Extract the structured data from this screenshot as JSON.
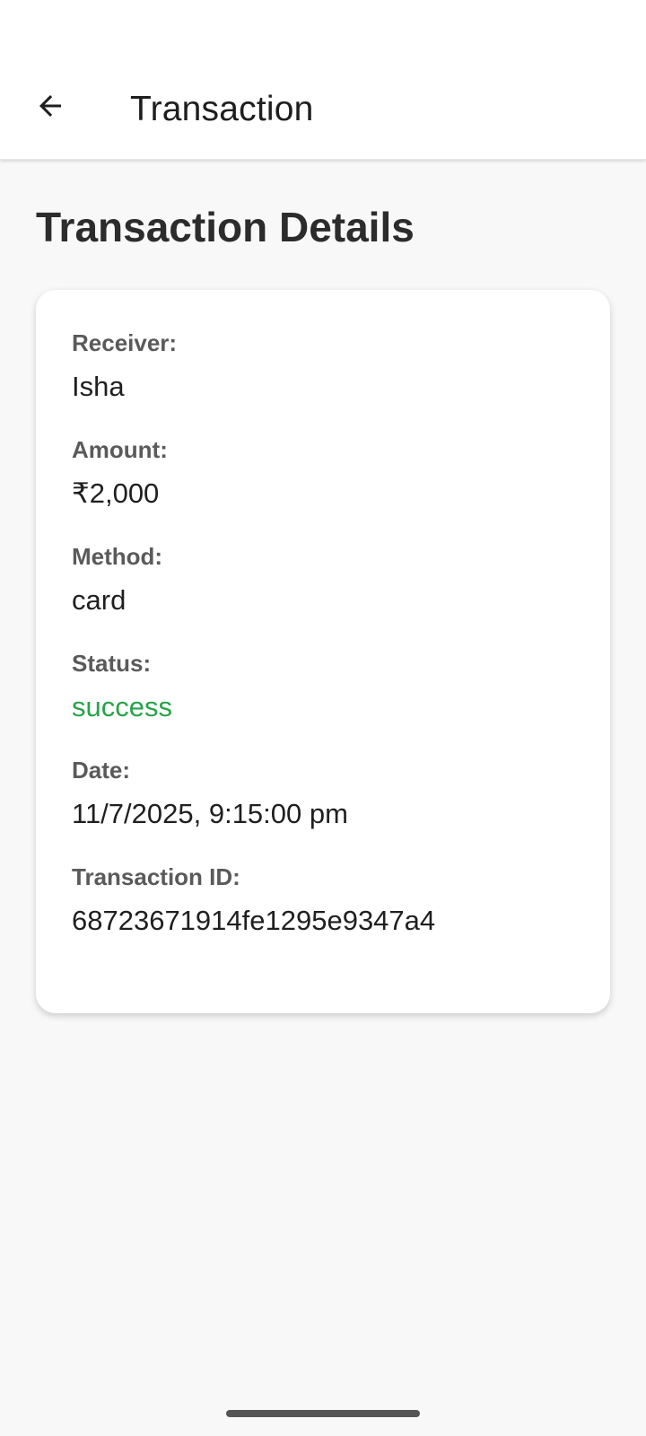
{
  "app_bar": {
    "title": "Transaction",
    "back_icon": "arrow-left-icon"
  },
  "page": {
    "heading": "Transaction Details"
  },
  "details": {
    "receiver_label": "Receiver:",
    "receiver_value": "Isha",
    "amount_label": "Amount:",
    "amount_value": "₹2,000",
    "method_label": "Method:",
    "method_value": "card",
    "status_label": "Status:",
    "status_value": "success",
    "date_label": "Date:",
    "date_value": "11/7/2025, 9:15:00 pm",
    "id_label": "Transaction ID:",
    "id_value": "68723671914fe1295e9347a4"
  },
  "colors": {
    "status_success": "#27a34a",
    "background": "#f8f8f8",
    "card": "#ffffff"
  }
}
